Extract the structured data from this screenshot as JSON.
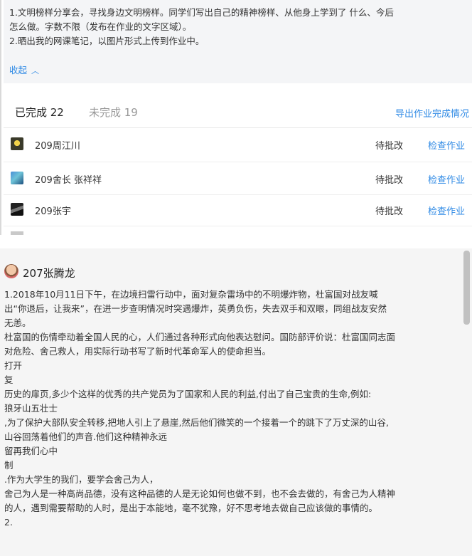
{
  "assignment": {
    "description_lines": [
      "1.文明榜样分享会，寻找身边文明榜样。同学们写出自己的精神榜样、从他身上学到了   什么、今后",
      "怎么做。字数不限（发布在作业的文字区域）。",
      "2.晒出我的网课笔记，以图片形式上传到作业中。"
    ],
    "collapse_label": "收起",
    "collapse_icon": "chevron-up-icon"
  },
  "tabs": {
    "completed_label": "已完成 22",
    "incomplete_label": "未完成 19",
    "export_label": "导出作业完成情况"
  },
  "students": [
    {
      "name": "209周江川",
      "status": "待批改",
      "action": "检查作业"
    },
    {
      "name": "209舍长 张祥祥",
      "status": "待批改",
      "action": "检查作业"
    },
    {
      "name": "209张宇",
      "status": "待批改",
      "action": "检查作业"
    }
  ],
  "submission": {
    "author": "207张腾龙",
    "lines": [
      "1.2018年10月11日下午，在边境扫雷行动中，面对复杂雷场中的不明爆炸物，杜富国对战友喊",
      "出“你退后，让我来”，在进一步查明情况时突遇爆炸，英勇负伤，失去双手和双眼，同组战友安然",
      "无恙。",
      "杜富国的伤情牵动着全国人民的心，人们通过各种形式向他表达慰问。国防部评价说：杜富国同志面",
      "对危险、舍己救人，用实际行动书写了新时代革命军人的使命担当。",
      "打开",
      "复",
      "历史的扉页,多少个这样的优秀的共产党员为了国家和人民的利益,付出了自己宝贵的生命,例如:",
      "狼牙山五壮士",
      ",为了保护大部队安全转移,把地人引上了悬崖,然后他们微笑的一个接着一个的跳下了万丈深的山谷,",
      "山谷回荡着他们的声音.他们这种精神永远",
      "留再我们心中",
      "制",
      ".作为大学生的我们，要学会舍己为人，",
      "舍己为人是一种高尚品德，没有这种品德的人是无论如何也做不到，也不会去做的，有舍己为人精神",
      "的人，遇到需要帮助的人时，是出于本能地，毫不犹豫，好不思考地去做自己应该做的事情的。",
      "2."
    ]
  },
  "colors": {
    "accent": "#2f8ae5",
    "panel_bg": "#f4f5f7",
    "text": "#333333"
  }
}
